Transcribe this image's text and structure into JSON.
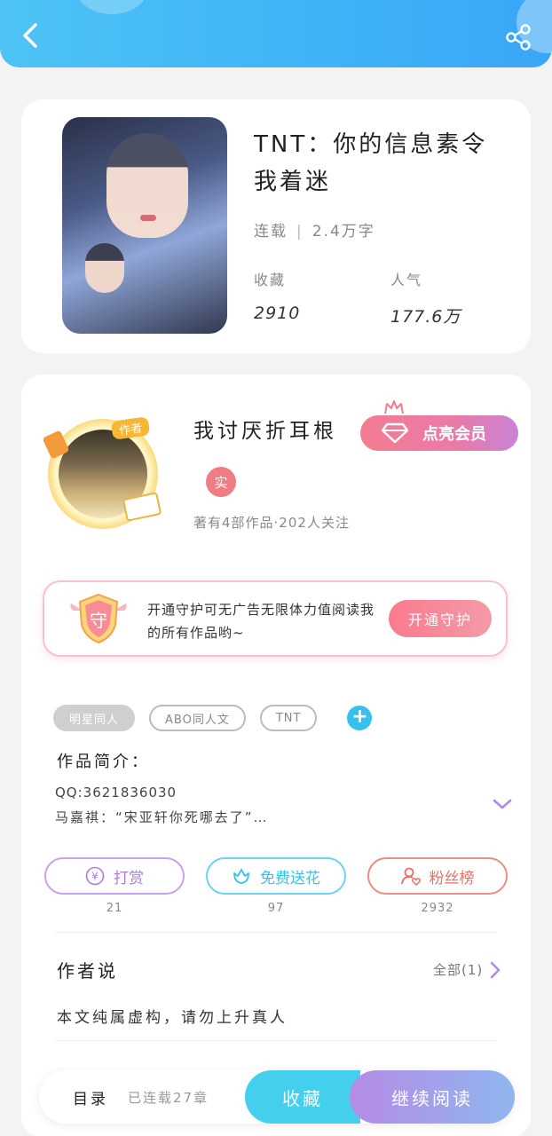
{
  "book": {
    "title": "TNT：你的信息素令我着迷",
    "status": "连载",
    "word_count": "2.4万字",
    "favorites_label": "收藏",
    "favorites_value": "2910",
    "popularity_label": "人气",
    "popularity_value": "177.6万"
  },
  "author": {
    "avatar_tag": "作者",
    "name": "我讨厌折耳根",
    "vip_button": "点亮会员",
    "real_badge": "实",
    "stats": "著有4部作品·202人关注"
  },
  "guard": {
    "shield_char": "守",
    "text": "开通守护可无广告无限体力值阅读我的所有作品哟~",
    "button": "开通守护"
  },
  "tags": [
    "明星同人",
    "ABO同人文",
    "TNT"
  ],
  "intro": {
    "label": "作品简介：",
    "line1": "QQ:3621836030",
    "line2": "马嘉祺：“宋亚轩你死哪去了”…"
  },
  "actions": [
    {
      "label": "打赏",
      "count": "21"
    },
    {
      "label": "免费送花",
      "count": "97"
    },
    {
      "label": "粉丝榜",
      "count": "2932"
    }
  ],
  "author_says": {
    "title": "作者说",
    "view_all": "全部(1)",
    "note": "本文纯属虚构，请勿上升真人"
  },
  "bottom_bar": {
    "toc": "目录",
    "chapters": "已连载27章",
    "collect": "收藏",
    "read": "继续阅读"
  },
  "colors": {
    "header": "#3fb2f8",
    "vip": "#f57c91",
    "accent_blue": "#45cfef",
    "accent_purple": "#b58be6"
  }
}
